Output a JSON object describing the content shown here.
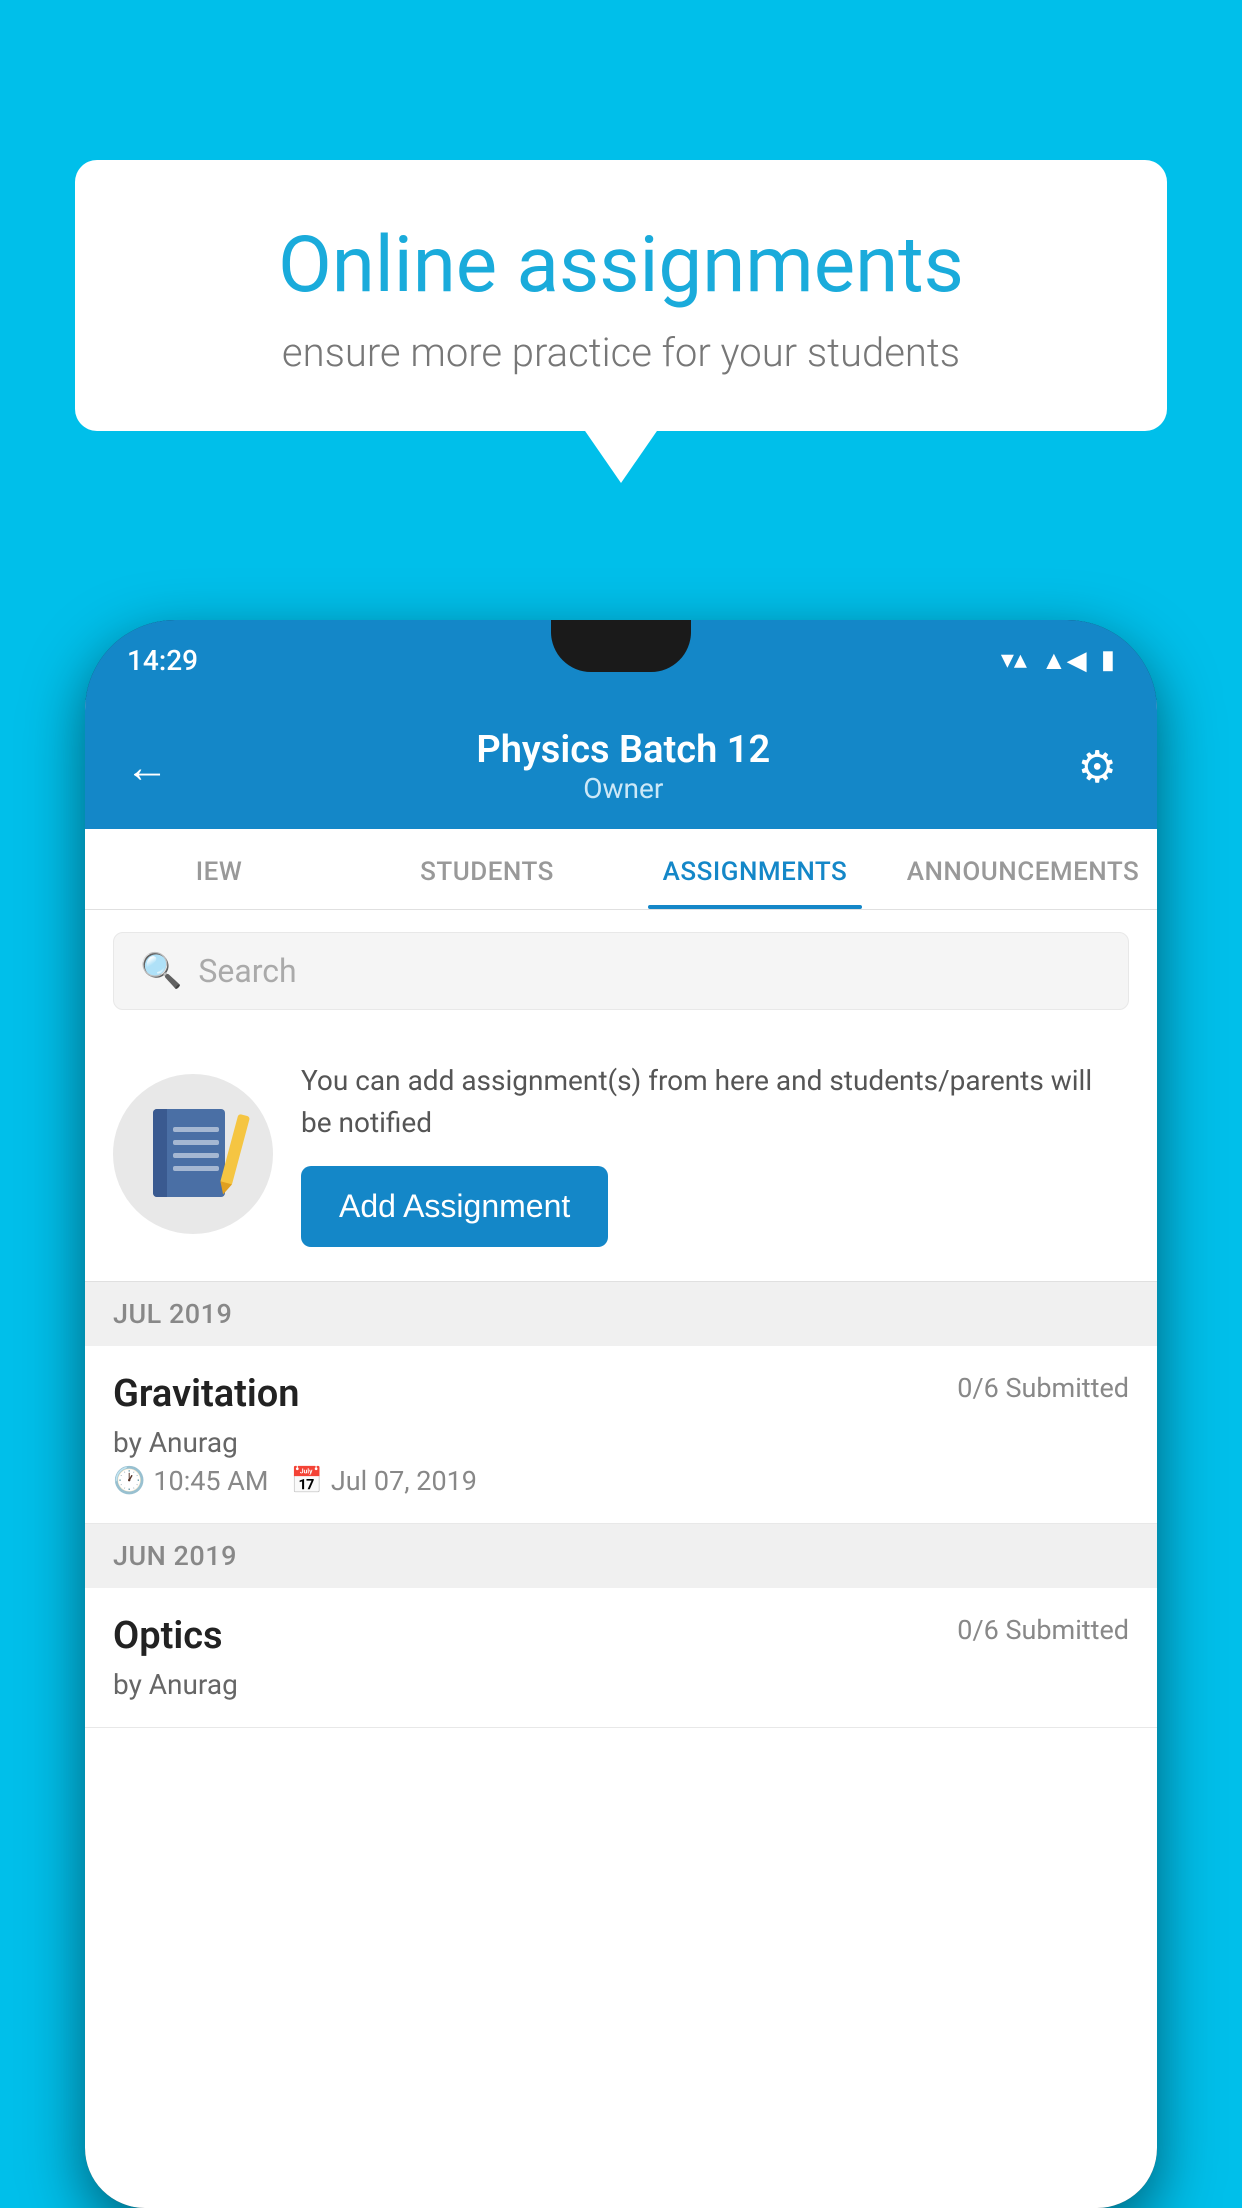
{
  "background_color": "#00BFEA",
  "speech_bubble": {
    "heading": "Online assignments",
    "subtext": "ensure more practice for your students"
  },
  "status_bar": {
    "time": "14:29",
    "icons": [
      "wifi",
      "signal",
      "battery"
    ]
  },
  "app_header": {
    "title": "Physics Batch 12",
    "subtitle": "Owner",
    "back_label": "←",
    "settings_label": "⚙"
  },
  "tabs": [
    {
      "label": "IEW",
      "active": false
    },
    {
      "label": "STUDENTS",
      "active": false
    },
    {
      "label": "ASSIGNMENTS",
      "active": true
    },
    {
      "label": "ANNOUNCEMENTS",
      "active": false
    }
  ],
  "search": {
    "placeholder": "Search"
  },
  "promo": {
    "text": "You can add assignment(s) from here and students/parents will be notified",
    "button_label": "Add Assignment"
  },
  "sections": [
    {
      "month_label": "JUL 2019",
      "assignments": [
        {
          "title": "Gravitation",
          "submitted": "0/6 Submitted",
          "author": "by Anurag",
          "time": "10:45 AM",
          "date": "Jul 07, 2019"
        }
      ]
    },
    {
      "month_label": "JUN 2019",
      "assignments": [
        {
          "title": "Optics",
          "submitted": "0/6 Submitted",
          "author": "by Anurag",
          "time": "",
          "date": ""
        }
      ]
    }
  ],
  "colors": {
    "primary": "#1487C8",
    "background": "#00BFEA",
    "white": "#ffffff",
    "tab_active": "#1487C8",
    "section_bg": "#f0f0f0"
  }
}
